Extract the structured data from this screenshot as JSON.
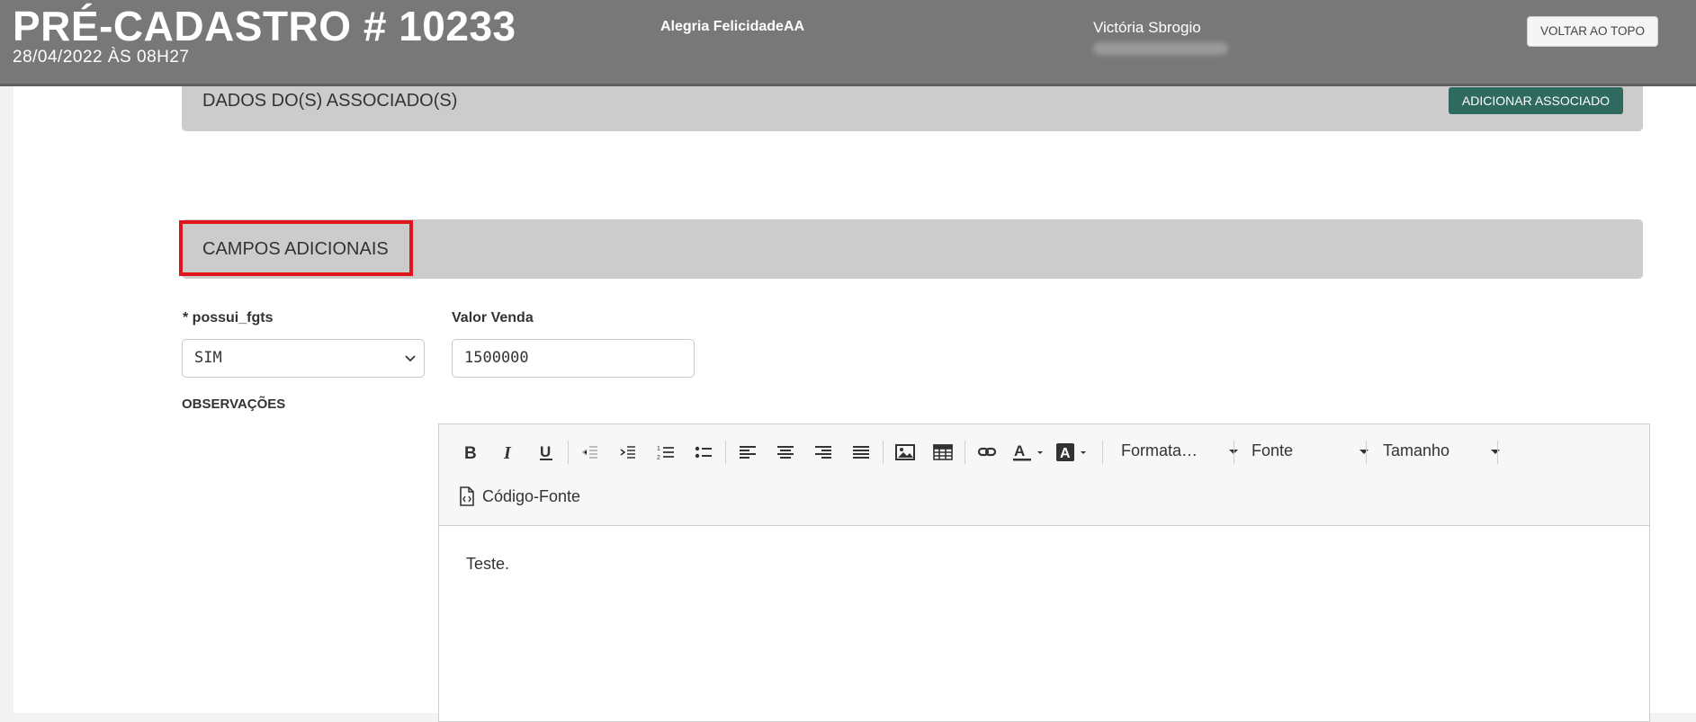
{
  "header": {
    "title": "PRÉ-CADASTRO # 10233",
    "date": "28/04/2022 ÀS 08H27",
    "client": "Alegria FelicidadeAA",
    "user": "Victória Sbrogio",
    "back_to_top": "VOLTAR AO TOPO"
  },
  "sections": {
    "associados": {
      "title": "DADOS DO(S) ASSOCIADO(S)",
      "add_button": "ADICIONAR ASSOCIADO"
    },
    "campos": {
      "title": "CAMPOS ADICIONAIS"
    }
  },
  "form": {
    "fgts_label": "* possui_fgts",
    "fgts_value": "SIM",
    "valor_label": "Valor Venda",
    "valor_value": "1500000",
    "obs_label": "OBSERVAÇÕES"
  },
  "editor": {
    "format_dropdown": "Formata…",
    "font_dropdown": "Fonte",
    "size_dropdown": "Tamanho",
    "source_button": "Código-Fonte",
    "content": "Teste."
  },
  "colors": {
    "header_bg": "#787878",
    "section_bg": "#cccccc",
    "accent_green": "#2e6b5e",
    "highlight_red": "#e0151b"
  }
}
